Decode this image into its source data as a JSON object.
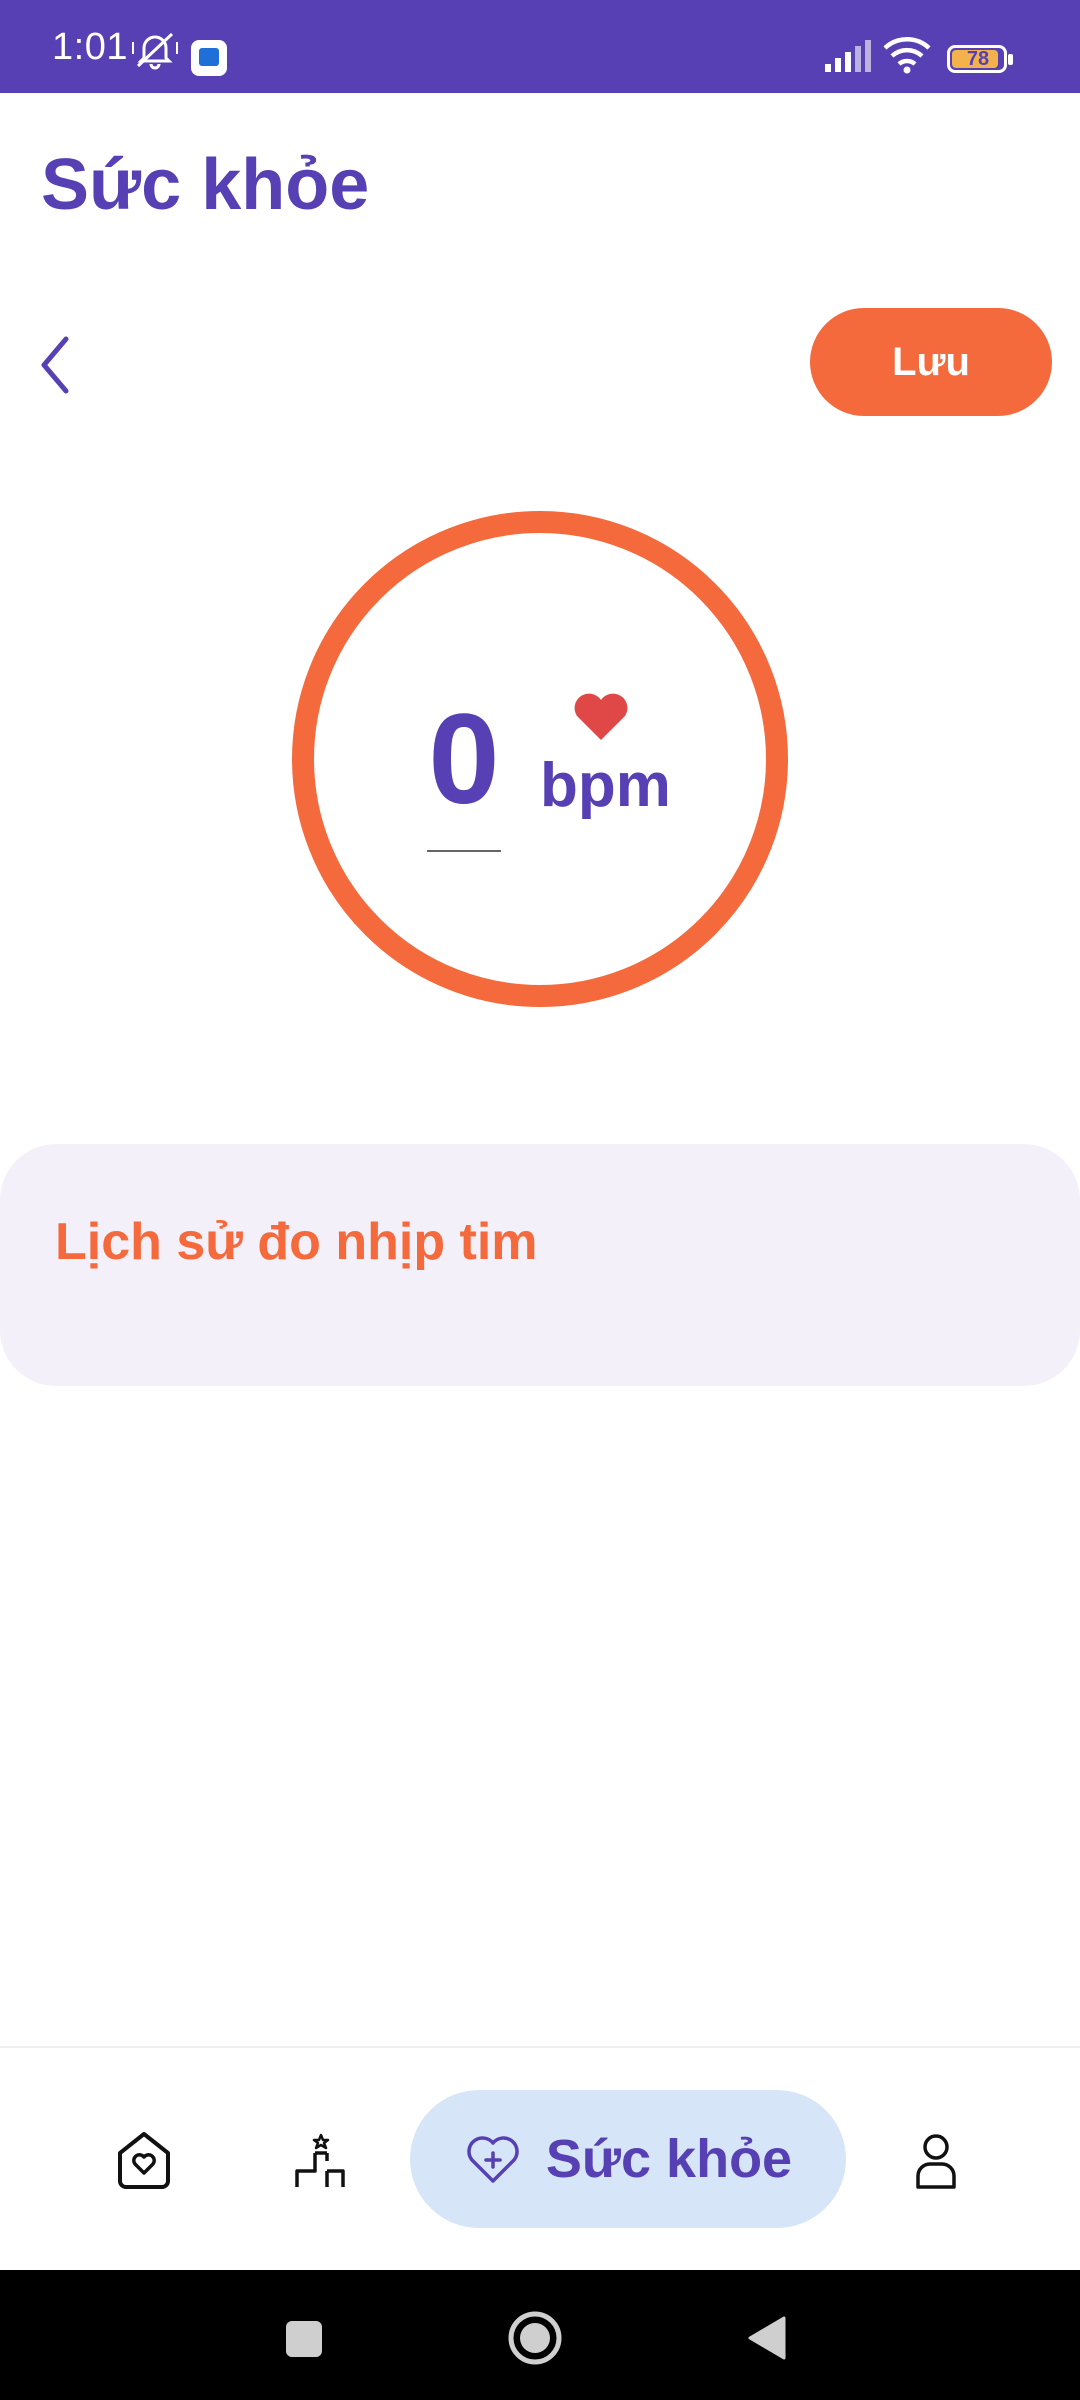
{
  "status_bar": {
    "time": "1:01",
    "battery_level": "78",
    "icons": [
      "mute-icon",
      "app-notification-icon",
      "signal-icon",
      "wifi-icon",
      "battery-icon"
    ]
  },
  "header": {
    "title": "Sức khỏe"
  },
  "toolbar": {
    "back_icon": "chevron-left-icon",
    "save_label": "Lưu"
  },
  "heart_rate": {
    "value": "0",
    "unit": "bpm",
    "icon": "heart-icon"
  },
  "history": {
    "title": "Lịch sử đo nhịp tim"
  },
  "bottom_nav": {
    "items": [
      {
        "icon": "home-heart-icon",
        "label": ""
      },
      {
        "icon": "exercise-icon",
        "label": ""
      },
      {
        "icon": "heart-plus-icon",
        "label": "Sức khỏe",
        "active": true
      },
      {
        "icon": "person-icon",
        "label": ""
      }
    ]
  },
  "system_nav": {
    "icons": [
      "recents-icon",
      "home-icon",
      "back-icon"
    ]
  },
  "colors": {
    "primary": "#5640b3",
    "accent": "#f46a3c",
    "card": "#f3f0f9",
    "nav_active": "#d6e6f8",
    "heart": "#e04848"
  }
}
